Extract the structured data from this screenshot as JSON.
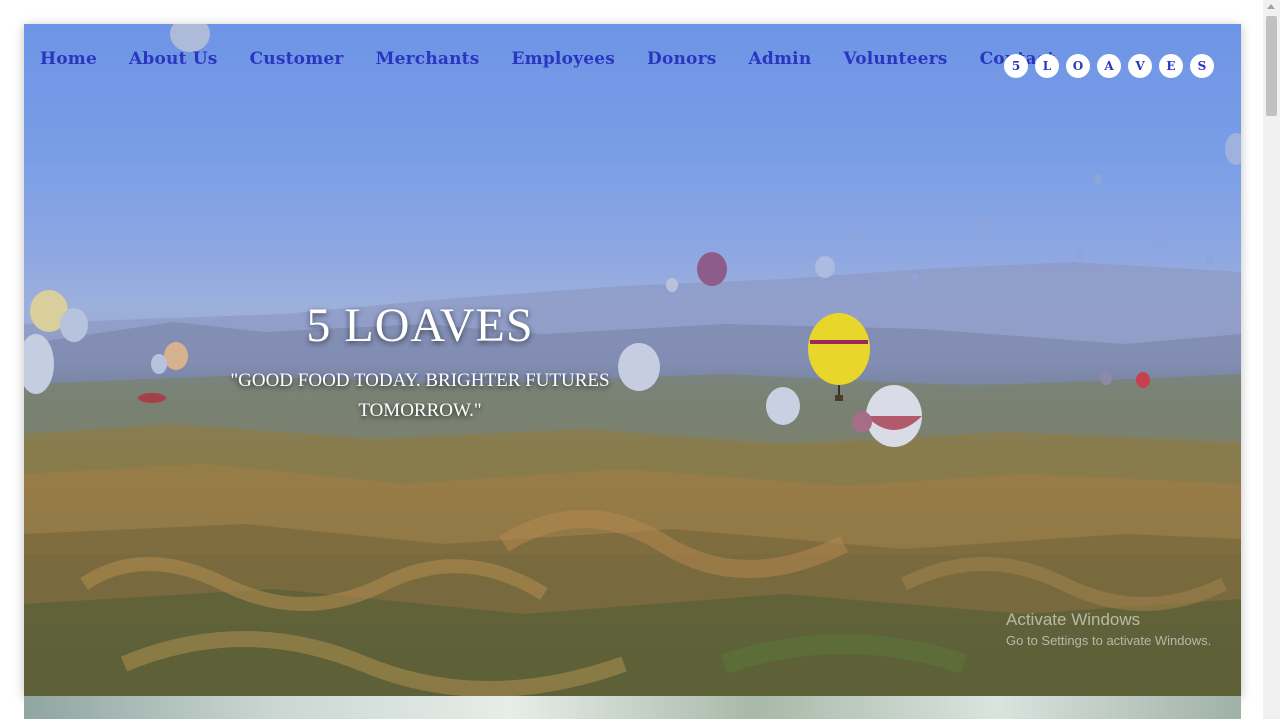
{
  "nav": {
    "items": [
      "Home",
      "About Us",
      "Customer",
      "Merchants",
      "Employees",
      "Donors",
      "Admin",
      "Volunteers",
      "Contact"
    ]
  },
  "logo": {
    "letters": [
      "5",
      "L",
      "O",
      "A",
      "V",
      "E",
      "S"
    ]
  },
  "hero": {
    "title": "5 LOAVES",
    "tagline": "\"GOOD FOOD TODAY. BRIGHTER FUTURES TOMORROW.\""
  },
  "watermark": {
    "line1": "Activate Windows",
    "line2": "Go to Settings to activate Windows."
  },
  "colors": {
    "nav_link": "#2a35c0",
    "hero_text": "#ffffff"
  }
}
